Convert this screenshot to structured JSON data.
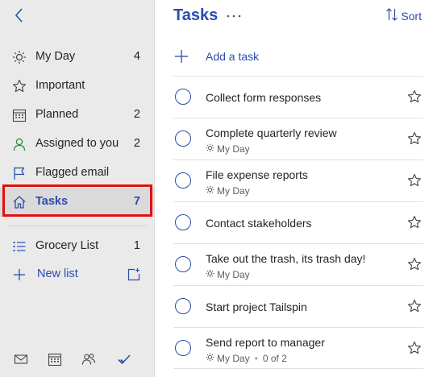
{
  "sidebar": {
    "items": [
      {
        "label": "My Day",
        "count": "4",
        "icon": "sun-icon"
      },
      {
        "label": "Important",
        "count": "",
        "icon": "star-icon"
      },
      {
        "label": "Planned",
        "count": "2",
        "icon": "calendar-icon"
      },
      {
        "label": "Assigned to you",
        "count": "2",
        "icon": "person-icon"
      },
      {
        "label": "Flagged email",
        "count": "",
        "icon": "flag-icon"
      },
      {
        "label": "Tasks",
        "count": "7",
        "icon": "home-icon"
      }
    ],
    "lists": [
      {
        "label": "Grocery List",
        "count": "1",
        "icon": "list-icon"
      }
    ],
    "new_list_label": "New list",
    "footer_icons": [
      "mail-icon",
      "calendar-icon",
      "people-icon",
      "checkmark-icon"
    ]
  },
  "main": {
    "title": "Tasks",
    "sort_label": "Sort",
    "add_task_label": "Add a task",
    "tasks": [
      {
        "title": "Collect form responses"
      },
      {
        "title": "Complete quarterly review",
        "myday": "My Day"
      },
      {
        "title": "File expense reports",
        "myday": "My Day"
      },
      {
        "title": "Contact stakeholders"
      },
      {
        "title": "Take out the trash, its trash day!",
        "myday": "My Day"
      },
      {
        "title": "Start project Tailspin"
      },
      {
        "title": "Send report to manager",
        "myday": "My Day",
        "steps": "0 of 2"
      }
    ]
  },
  "colors": {
    "accent": "#2b4cae",
    "sidebar_bg": "#eaeaea",
    "selected_bg": "#dadada",
    "highlight": "#e01010"
  }
}
